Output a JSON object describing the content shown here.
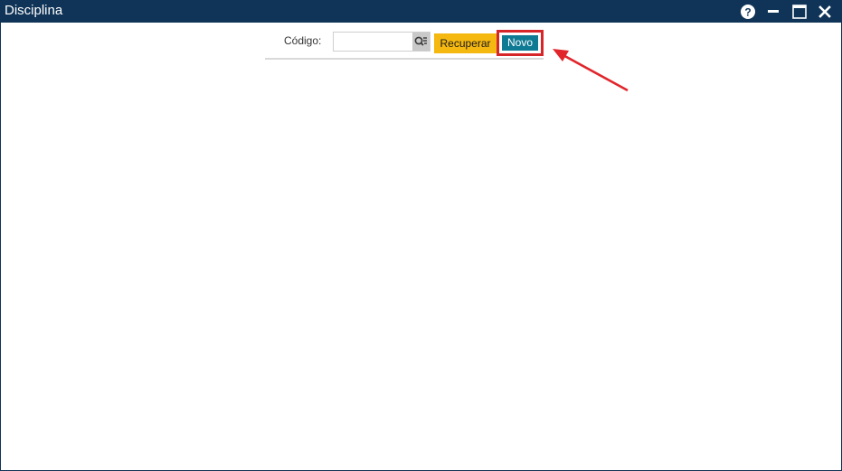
{
  "window": {
    "title": "Disciplina"
  },
  "title_controls": [
    {
      "icon": "help-icon"
    },
    {
      "icon": "minimize-icon"
    },
    {
      "icon": "maximize-icon"
    },
    {
      "icon": "close-icon"
    }
  ],
  "form": {
    "codigo_label": "Código:",
    "codigo_value": "",
    "codigo_placeholder": "",
    "lookup_icon": "search-list-icon"
  },
  "buttons": {
    "recuperar_label": "Recuperar",
    "novo_label": "Novo"
  },
  "colors": {
    "titlebar": "#0f3457",
    "recuperar": "#f5b810",
    "novo": "#0e7a93",
    "highlight": "#d7262a",
    "arrow": "#e0262b"
  }
}
